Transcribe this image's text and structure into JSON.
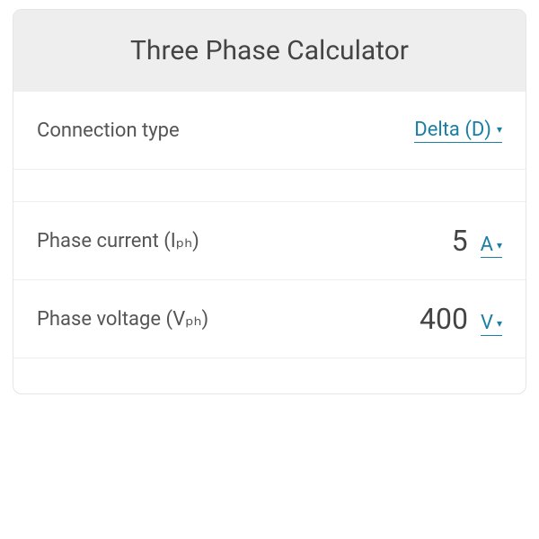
{
  "title": "Three Phase Calculator",
  "connection": {
    "label": "Connection type",
    "value": "Delta (D)"
  },
  "rows": [
    {
      "label": "Phase current (Iₚₕ)",
      "value": "5",
      "unit": "A"
    },
    {
      "label": "Phase voltage (Vₚₕ)",
      "value": "400",
      "unit": "V"
    },
    {
      "label": "",
      "value": "",
      "unit": ""
    }
  ],
  "colors": {
    "link": "#1a7fa3",
    "textMuted": "#555",
    "headerBg": "#eeeeee"
  }
}
